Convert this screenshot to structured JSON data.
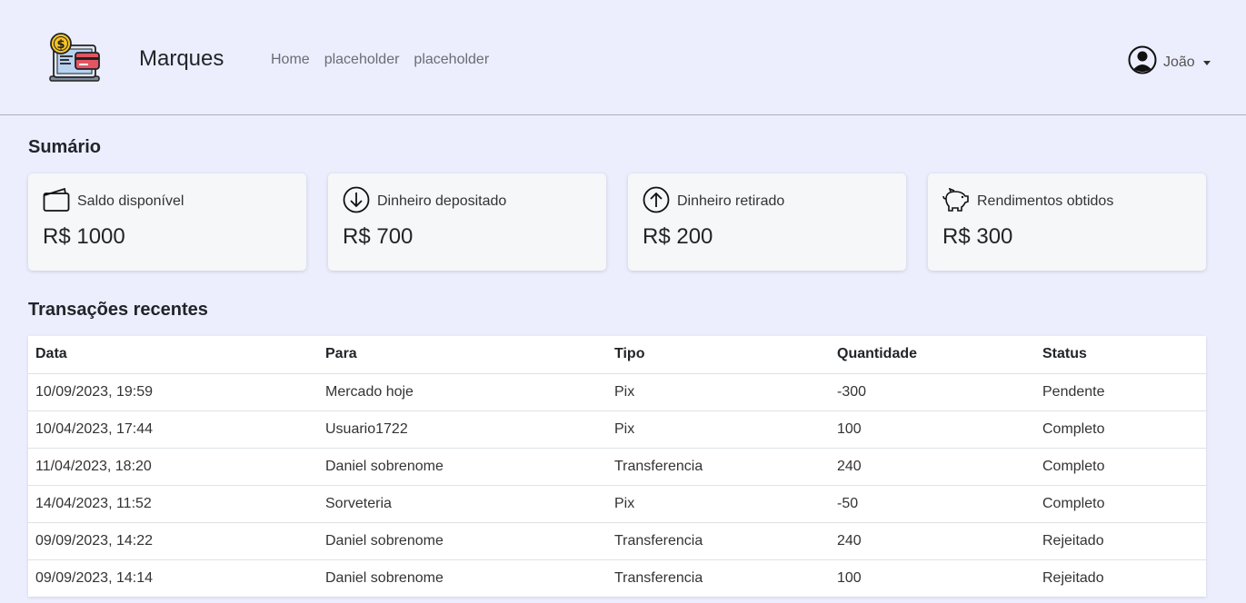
{
  "brand": {
    "name": "Marques",
    "logo_icon": "wallet-laptop-icon"
  },
  "nav": {
    "items": [
      "Home",
      "placeholder",
      "placeholder"
    ]
  },
  "user": {
    "name": "João",
    "icon": "user-circle-icon"
  },
  "summary": {
    "title": "Sumário",
    "cards": [
      {
        "icon": "wallet-icon",
        "label": "Saldo disponível",
        "value": "R$ 1000"
      },
      {
        "icon": "arrow-down-circle-icon",
        "label": "Dinheiro depositado",
        "value": "R$ 700"
      },
      {
        "icon": "arrow-up-circle-icon",
        "label": "Dinheiro retirado",
        "value": "R$ 200"
      },
      {
        "icon": "piggy-bank-icon",
        "label": "Rendimentos obtidos",
        "value": "R$ 300"
      }
    ]
  },
  "transactions": {
    "title": "Transações recentes",
    "columns": [
      "Data",
      "Para",
      "Tipo",
      "Quantidade",
      "Status"
    ],
    "rows": [
      [
        "10/09/2023, 19:59",
        "Mercado hoje",
        "Pix",
        "-300",
        "Pendente"
      ],
      [
        "10/04/2023, 17:44",
        "Usuario1722",
        "Pix",
        "100",
        "Completo"
      ],
      [
        "11/04/2023, 18:20",
        "Daniel sobrenome",
        "Transferencia",
        "240",
        "Completo"
      ],
      [
        "14/04/2023, 11:52",
        "Sorveteria",
        "Pix",
        "-50",
        "Completo"
      ],
      [
        "09/09/2023, 14:22",
        "Daniel sobrenome",
        "Transferencia",
        "240",
        "Rejeitado"
      ],
      [
        "09/09/2023, 14:14",
        "Daniel sobrenome",
        "Transferencia",
        "100",
        "Rejeitado"
      ]
    ]
  },
  "colors": {
    "background": "#eceefe",
    "card": "#f6f7f9",
    "table": "#ffffff"
  }
}
